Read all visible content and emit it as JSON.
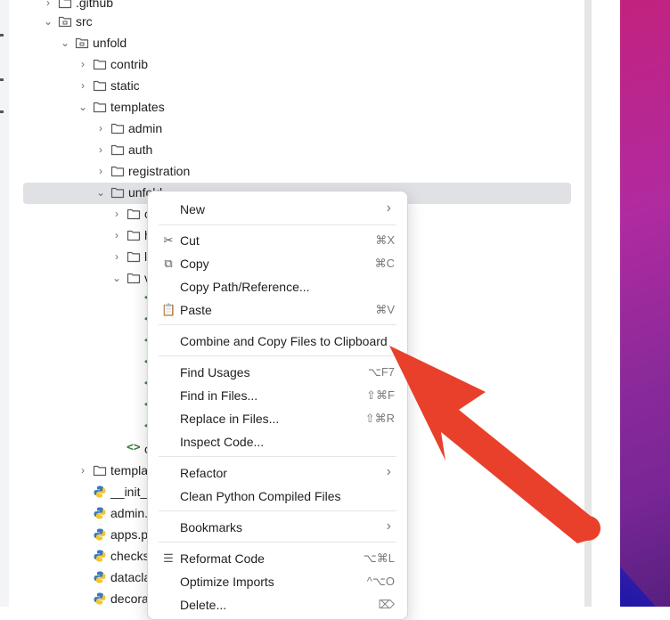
{
  "tree": [
    {
      "id": "github",
      "label": ".github",
      "chevron": "›",
      "icon": "folder",
      "indent": 0
    },
    {
      "id": "src",
      "label": "src",
      "chevron": "⌄",
      "icon": "folder-src",
      "indent": 0
    },
    {
      "id": "unfold",
      "label": "unfold",
      "chevron": "⌄",
      "icon": "folder-src",
      "indent": 1
    },
    {
      "id": "contrib",
      "label": "contrib",
      "chevron": "›",
      "icon": "folder",
      "indent": 2
    },
    {
      "id": "static",
      "label": "static",
      "chevron": "›",
      "icon": "folder",
      "indent": 2
    },
    {
      "id": "templates",
      "label": "templates",
      "chevron": "⌄",
      "icon": "folder",
      "indent": 2
    },
    {
      "id": "admin",
      "label": "admin",
      "chevron": "›",
      "icon": "folder",
      "indent": 3
    },
    {
      "id": "auth",
      "label": "auth",
      "chevron": "›",
      "icon": "folder",
      "indent": 3
    },
    {
      "id": "registration",
      "label": "registration",
      "chevron": "›",
      "icon": "folder",
      "indent": 3
    },
    {
      "id": "unfold-inner",
      "label": "unfold",
      "chevron": "⌄",
      "icon": "folder",
      "indent": 3,
      "selected": true
    },
    {
      "id": "c",
      "label": "c",
      "chevron": "›",
      "icon": "folder",
      "indent": 4
    },
    {
      "id": "h",
      "label": "h",
      "chevron": "›",
      "icon": "folder",
      "indent": 4
    },
    {
      "id": "l",
      "label": "l",
      "chevron": "›",
      "icon": "folder",
      "indent": 4
    },
    {
      "id": "v",
      "label": "v",
      "chevron": "⌄",
      "icon": "folder",
      "indent": 4
    },
    {
      "id": "h1",
      "label": "",
      "icon": "html",
      "indent": 5
    },
    {
      "id": "h2",
      "label": "",
      "icon": "html",
      "indent": 5
    },
    {
      "id": "h3",
      "label": "",
      "icon": "html",
      "indent": 5
    },
    {
      "id": "h4",
      "label": "",
      "icon": "html",
      "indent": 5
    },
    {
      "id": "h5",
      "label": "",
      "icon": "html",
      "indent": 5
    },
    {
      "id": "h6",
      "label": "",
      "icon": "html",
      "indent": 5
    },
    {
      "id": "h7",
      "label": "",
      "icon": "html",
      "indent": 5
    },
    {
      "id": "h8",
      "label": "c",
      "icon": "html",
      "indent": 4
    },
    {
      "id": "templa",
      "label": "templa",
      "chevron": "›",
      "icon": "folder",
      "indent": 2
    },
    {
      "id": "init",
      "label": "__init__",
      "icon": "python",
      "indent": 2
    },
    {
      "id": "admin-py",
      "label": "admin.",
      "icon": "python",
      "indent": 2
    },
    {
      "id": "apps-py",
      "label": "apps.p",
      "icon": "python",
      "indent": 2
    },
    {
      "id": "checks-py",
      "label": "checks",
      "icon": "python",
      "indent": 2
    },
    {
      "id": "datacla-py",
      "label": "datacla",
      "icon": "python",
      "indent": 2
    },
    {
      "id": "decora-py",
      "label": "decora",
      "icon": "python",
      "indent": 2
    }
  ],
  "menu": [
    {
      "label": "New",
      "submenu": true
    },
    {
      "sep": true
    },
    {
      "label": "Cut",
      "icon": "✂",
      "shortcut": "⌘X"
    },
    {
      "label": "Copy",
      "icon": "⧉",
      "shortcut": "⌘C"
    },
    {
      "label": "Copy Path/Reference..."
    },
    {
      "label": "Paste",
      "icon": "📋",
      "shortcut": "⌘V"
    },
    {
      "sep": true
    },
    {
      "label": "Combine and Copy Files to Clipboard"
    },
    {
      "sep": true
    },
    {
      "label": "Find Usages",
      "shortcut": "⌥F7"
    },
    {
      "label": "Find in Files...",
      "shortcut": "⇧⌘F"
    },
    {
      "label": "Replace in Files...",
      "shortcut": "⇧⌘R"
    },
    {
      "label": "Inspect Code..."
    },
    {
      "sep": true
    },
    {
      "label": "Refactor",
      "submenu": true
    },
    {
      "label": "Clean Python Compiled Files"
    },
    {
      "sep": true
    },
    {
      "label": "Bookmarks",
      "submenu": true
    },
    {
      "sep": true
    },
    {
      "label": "Reformat Code",
      "icon": "☰",
      "shortcut": "⌥⌘L"
    },
    {
      "label": "Optimize Imports",
      "shortcut": "^⌥O"
    },
    {
      "label": "Delete...",
      "shortcut": "⌦"
    }
  ],
  "colors": {
    "arrow": "#e8402a",
    "selection": "#dfe1e5"
  }
}
